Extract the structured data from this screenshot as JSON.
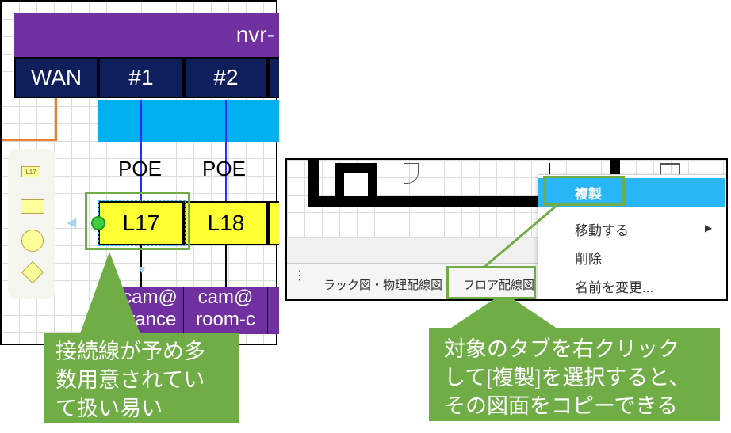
{
  "left_panel": {
    "top_banner": "nvr-",
    "header_cells": [
      "WAN",
      "#1",
      "#2"
    ],
    "poe_labels": [
      "POE",
      "POE"
    ],
    "port_labels": [
      "L17",
      "L18"
    ],
    "cam_labels": [
      {
        "line1": "cam@",
        "line2": "trance"
      },
      {
        "line1": "cam@",
        "line2": "room-c"
      }
    ],
    "shape_palette": {
      "small_label": "L17"
    }
  },
  "right_panel": {
    "tabs": [
      "ラック図・物理配線図",
      "フロア配線図"
    ],
    "context_menu": [
      {
        "label": "複製",
        "selected": true
      },
      {
        "label": "移動する",
        "has_submenu": true
      },
      {
        "label": "削除"
      },
      {
        "label": "名前を変更..."
      }
    ]
  },
  "callouts": {
    "left": [
      "接続線が予め多",
      "数用意されてい",
      "て扱い易い"
    ],
    "right": [
      "対象のタブを右クリック",
      "して[複製]を選択すると、",
      "その図面をコピーできる"
    ]
  },
  "colors": {
    "purple": "#7030a0",
    "navy": "#0f1f5c",
    "cyan": "#00b0f0",
    "yellow": "#ffff33",
    "callout_green": "#70ad47",
    "menu_highlight": "#29b6f6"
  }
}
